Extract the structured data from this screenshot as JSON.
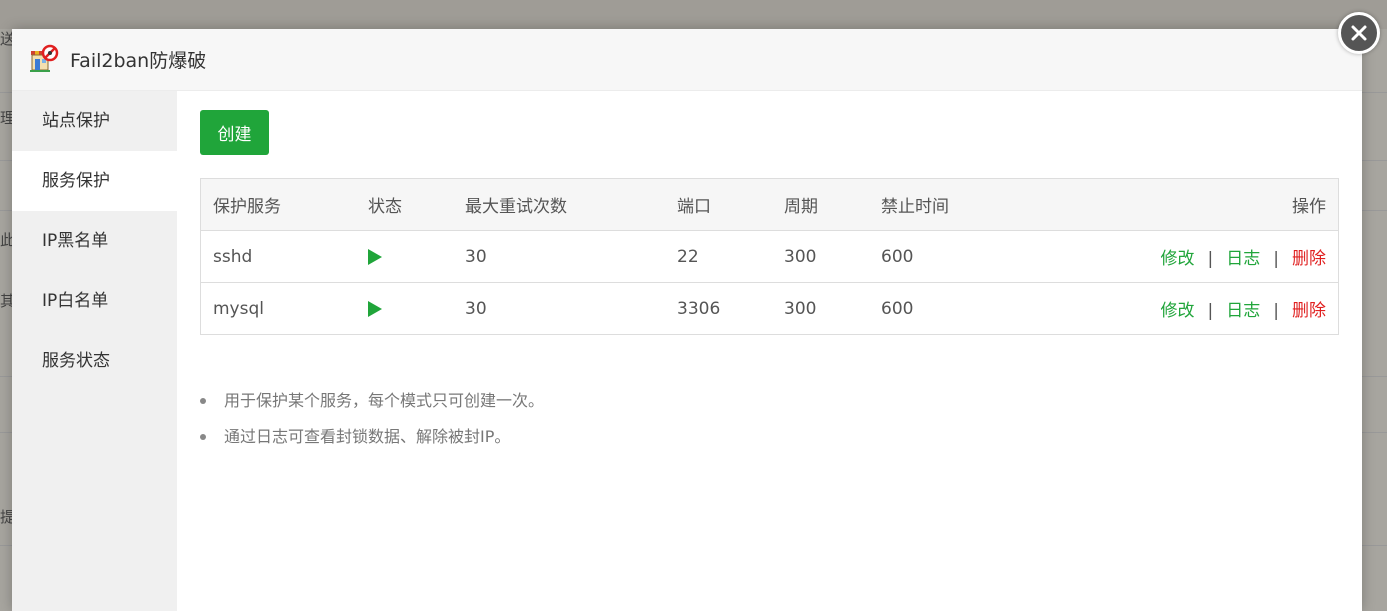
{
  "background": {
    "fragments": [
      "送",
      "理",
      "此",
      "其",
      "提"
    ]
  },
  "modal": {
    "title": "Fail2ban防爆破",
    "logo_icon": "shop-stop-icon",
    "close_icon": "close-icon"
  },
  "sidebar": {
    "items": [
      {
        "label": "站点保护",
        "active": false
      },
      {
        "label": "服务保护",
        "active": true
      },
      {
        "label": "IP黑名单",
        "active": false
      },
      {
        "label": "IP白名单",
        "active": false
      },
      {
        "label": "服务状态",
        "active": false
      }
    ]
  },
  "toolbar": {
    "create_label": "创建"
  },
  "table": {
    "headers": [
      "保护服务",
      "状态",
      "最大重试次数",
      "端口",
      "周期",
      "禁止时间",
      "操作"
    ],
    "rows": [
      {
        "service": "sshd",
        "status": "running",
        "max_retry": "30",
        "port": "22",
        "period": "300",
        "ban_time": "600"
      },
      {
        "service": "mysql",
        "status": "running",
        "max_retry": "30",
        "port": "3306",
        "period": "300",
        "ban_time": "600"
      }
    ],
    "actions": {
      "edit": "修改",
      "log": "日志",
      "delete": "删除",
      "separator": "|"
    }
  },
  "notes": [
    "用于保护某个服务，每个模式只可创建一次。",
    "通过日志可查看封锁数据、解除被封IP。"
  ],
  "colors": {
    "accent": "#20a53a",
    "danger": "#e02020"
  }
}
